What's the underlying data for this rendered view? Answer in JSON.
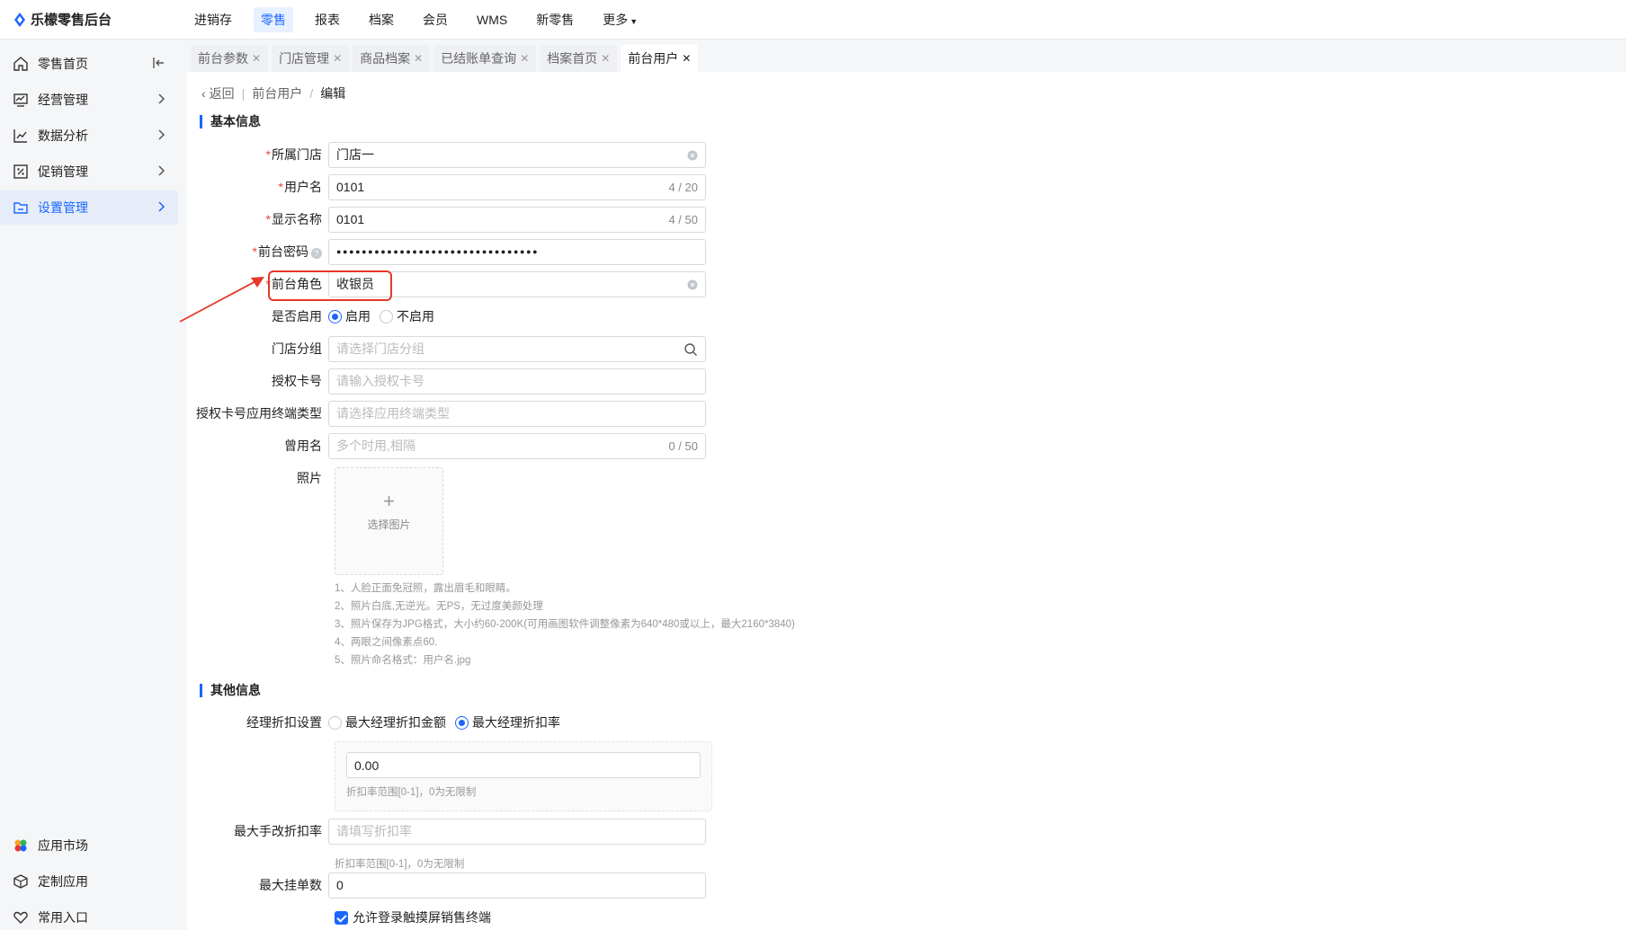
{
  "app": {
    "title": "乐檬零售后台"
  },
  "topnav": {
    "items": [
      {
        "label": "进销存",
        "active": false
      },
      {
        "label": "零售",
        "active": true
      },
      {
        "label": "报表",
        "active": false
      },
      {
        "label": "档案",
        "active": false
      },
      {
        "label": "会员",
        "active": false
      },
      {
        "label": "WMS",
        "active": false
      },
      {
        "label": "新零售",
        "active": false
      },
      {
        "label": "更多",
        "active": false
      }
    ]
  },
  "sidebar": {
    "items": [
      {
        "label": "零售首页",
        "icon": "home-icon"
      },
      {
        "label": "经营管理",
        "icon": "chart-board-icon"
      },
      {
        "label": "数据分析",
        "icon": "line-chart-icon"
      },
      {
        "label": "促销管理",
        "icon": "promotion-icon"
      },
      {
        "label": "设置管理",
        "icon": "folder-icon",
        "active": true
      }
    ],
    "bottom_items": [
      {
        "label": "应用市场",
        "icon": "app-market-icon"
      },
      {
        "label": "定制应用",
        "icon": "cube-icon"
      },
      {
        "label": "常用入口",
        "icon": "heart-icon"
      }
    ]
  },
  "tabs": [
    {
      "label": "前台参数"
    },
    {
      "label": "门店管理"
    },
    {
      "label": "商品档案"
    },
    {
      "label": "已结账单查询"
    },
    {
      "label": "档案首页"
    },
    {
      "label": "前台用户",
      "active": true
    }
  ],
  "breadcrumb": {
    "back": "返回",
    "parent": "前台用户",
    "separator": "/",
    "current": "编辑"
  },
  "basic_section": {
    "title": "基本信息",
    "store": {
      "label": "所属门店",
      "value": "门店一"
    },
    "username": {
      "label": "用户名",
      "value": "0101",
      "count": "4 / 20"
    },
    "display_name": {
      "label": "显示名称",
      "value": "0101",
      "count": "4 / 50"
    },
    "password": {
      "label": "前台密码",
      "value": "●●●●●●●●●●●●●●●●●●●●●●●●●●●●●●●●"
    },
    "role": {
      "label": "前台角色",
      "value": "收银员"
    },
    "enabled": {
      "label": "是否启用",
      "options": [
        "启用",
        "不启用"
      ],
      "selected": "启用"
    },
    "store_group": {
      "label": "门店分组",
      "placeholder": "请选择门店分组"
    },
    "auth_card": {
      "label": "授权卡号",
      "placeholder": "请输入授权卡号"
    },
    "auth_terminal": {
      "label": "授权卡号应用终端类型",
      "placeholder": "请选择应用终端类型"
    },
    "alias": {
      "label": "曾用名",
      "placeholder": "多个时用,相隔",
      "count": "0 / 50"
    },
    "photo": {
      "label": "照片",
      "upload_text": "选择图片",
      "plus": "+"
    },
    "photo_hints": [
      "1、人脸正面免冠照，露出眉毛和眼睛。",
      "2、照片白底,无逆光。无PS，无过度美颜处理",
      "3、照片保存为JPG格式，大小约60-200K(可用画图软件调整像素为640*480或以上，最大2160*3840)",
      "4、两眼之间像素点60.",
      "5、照片命名格式：用户名.jpg"
    ]
  },
  "other_section": {
    "title": "其他信息",
    "manager_discount": {
      "label": "经理折扣设置",
      "options": [
        "最大经理折扣金额",
        "最大经理折扣率"
      ],
      "selected": "最大经理折扣率"
    },
    "discount_value": "0.00",
    "discount_hint": "折扣率范围[0-1]，0为无限制",
    "max_manual_discount": {
      "label": "最大手改折扣率",
      "placeholder": "请填写折扣率",
      "hint": "折扣率范围[0-1]，0为无限制"
    },
    "max_pending": {
      "label": "最大挂单数",
      "value": "0"
    },
    "allow_touch": {
      "label": "允许登录触摸屏销售终端",
      "checked": true
    }
  },
  "colors": {
    "accent": "#1a66ff",
    "required": "#f04438",
    "highlight": "#e5392a"
  }
}
